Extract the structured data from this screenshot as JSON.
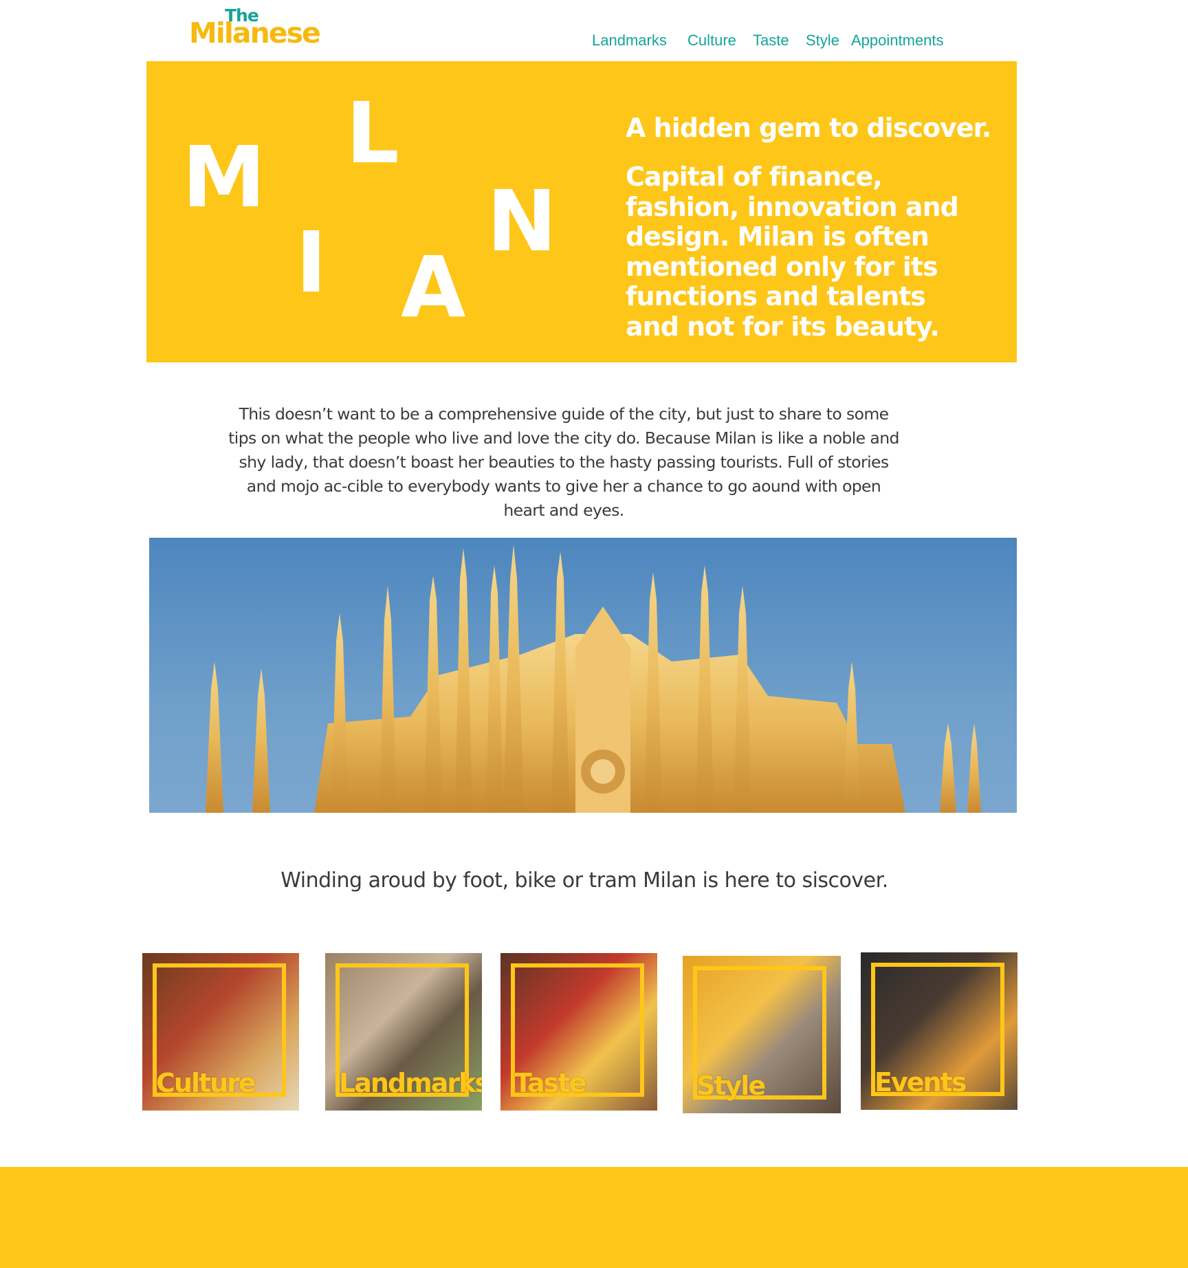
{
  "logo": {
    "the": "The",
    "name": "Milanese"
  },
  "nav": [
    {
      "label": "Landmarks"
    },
    {
      "label": "Culture"
    },
    {
      "label": "Taste"
    },
    {
      "label": "Style"
    },
    {
      "label": "Appointments"
    }
  ],
  "hero": {
    "letters": [
      "M",
      "I",
      "L",
      "A",
      "N"
    ],
    "tagline": "A hidden gem to discover.",
    "description": "Capital of finance, fashion, innovation and design. Milan is often mentioned only for its functions and talents and not for its beauty."
  },
  "intro": "This doesn’t want to be a comprehensive guide of the city, but just to share to some tips on what the people who live and love the city do. Because Milan is like a noble and shy lady, that doesn’t boast her beauties to the hasty passing tourists. Full of stories and mojo ac-cible to everybody wants to give her a chance to go aound with open heart and eyes.",
  "secondary": "Winding aroud by foot, bike or tram Milan is here to siscover.",
  "tiles": [
    {
      "label": "Culture"
    },
    {
      "label": "Landmarks"
    },
    {
      "label": "Taste"
    },
    {
      "label": "Style"
    },
    {
      "label": "Events"
    }
  ],
  "colors": {
    "accent": "#fec619",
    "nav": "#12a59a",
    "text": "#3a3a3a"
  }
}
